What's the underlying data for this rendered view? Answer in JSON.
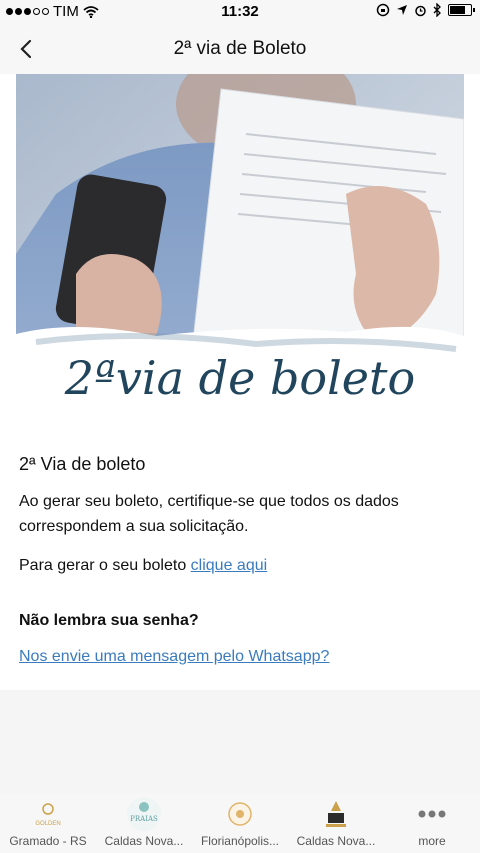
{
  "status": {
    "carrier": "TIM",
    "time": "11:32",
    "battery_level": 0.85
  },
  "nav": {
    "title": "2ª via de Boleto"
  },
  "hero": {
    "graphic_text": "2ªvia de boleto"
  },
  "content": {
    "title": "2ª Via de boleto",
    "paragraph": "Ao gerar seu boleto, certifique-se que todos os dados correspondem a sua solicitação.",
    "generate_prefix": "Para gerar o seu boleto ",
    "generate_link": "clique aqui",
    "password_question": "Não lembra sua senha?",
    "whatsapp_link": "Nos envie uma mensagem pelo Whatsapp?"
  },
  "tabs": [
    {
      "label": "Gramado - RS",
      "icon": "golden-logo-icon",
      "logo_text": "GOLDEN"
    },
    {
      "label": "Caldas Nova...",
      "icon": "praias-logo-icon",
      "logo_text": "PRAIAS"
    },
    {
      "label": "Florianópolis...",
      "icon": "resort-logo-icon",
      "logo_text": ""
    },
    {
      "label": "Caldas Nova...",
      "icon": "hotel-logo-icon",
      "logo_text": ""
    },
    {
      "label": "more",
      "icon": "more-icon",
      "logo_text": ""
    }
  ],
  "colors": {
    "link": "#3a7bbf",
    "hero_text": "#21455c"
  }
}
